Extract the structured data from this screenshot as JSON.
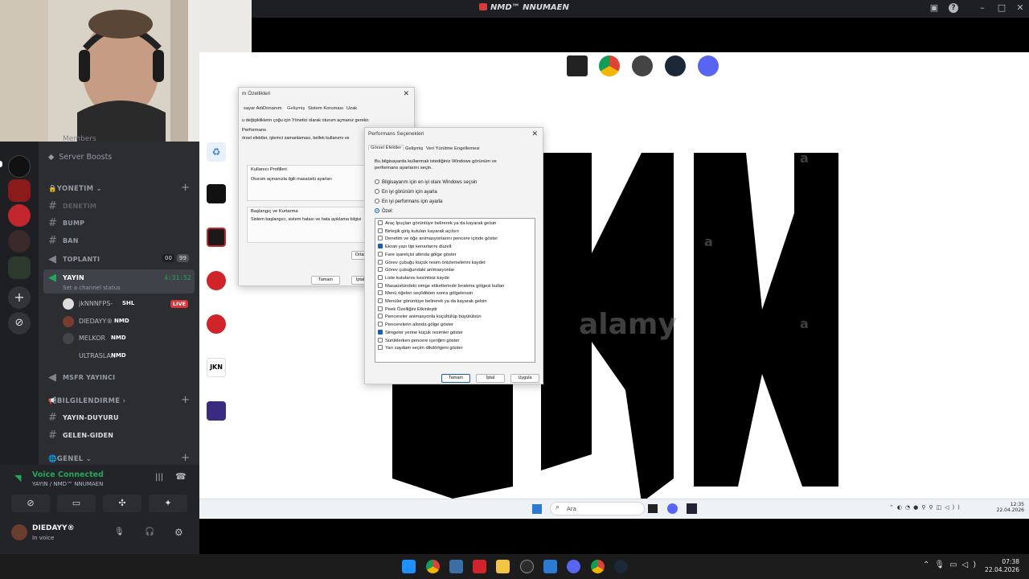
{
  "titlebar": {
    "title": "NMD™ NNUMAEN",
    "inbox_icon": "inbox-icon",
    "help_icon": "help-icon"
  },
  "discord": {
    "members_label": "Members",
    "server_boosts": "Server Boosts",
    "categories": {
      "yonetim": "YONETIM",
      "bilgilendirme": "BILGILENDIRME",
      "genel": "GENEL"
    },
    "channels": {
      "denetim": "DENETIM",
      "bump": "BUMP",
      "ban": "BAN",
      "toplanti": "TOPLANTI",
      "toplanti_count_a": "00",
      "toplanti_count_b": "99",
      "yayin": "YAYIN",
      "yayin_timer": "4:31:52",
      "set_status": "Set a channel status",
      "msfr": "MSFR YAYINCI",
      "duyuru": "YAYIN-DUYURU",
      "gelen": "GELEN-GIDEN"
    },
    "voice_users": [
      {
        "name": "jkNNNFPS-",
        "tag": "SHL",
        "live": "LIVE"
      },
      {
        "name": "DIEDAYY®",
        "tag": "NMD"
      },
      {
        "name": "MELKOR",
        "tag": "NMD"
      },
      {
        "name": "ULTRASLAN",
        "tag": "NMD"
      }
    ],
    "voice_panel": {
      "status": "Voice Connected",
      "channel": "YAYIN / NMD™ NNUMAEN",
      "username": "DIEDAYY®",
      "user_status": "In voice"
    }
  },
  "remote": {
    "bg_dialog": {
      "title": "m Özellikleri",
      "tabs": [
        "sayar Adı",
        "Donanım",
        "Gelişmiş",
        "Sistem Koruması",
        "Uzak"
      ],
      "note": "u değişikliklerin çoğu için Yönetici olarak oturum açmanız gerekir.",
      "perf_label": "Performans",
      "perf_text": "örsel efektler, işlemci zamanlaması, bellek kullanımı ve",
      "profile_label": "Kullanıcı Profilleri",
      "profile_text": "Oturum açmanızla ilgili masaüstü ayarları",
      "startup_label": "Başlangıç ve Kurtarma",
      "startup_text": "Sistem başlangıcı, sistem hatası ve hata ayıklama bilgisi",
      "btn_env": "Ortar",
      "btn_ok": "Tamam",
      "btn_cancel": "İptal"
    },
    "perf_dialog": {
      "title": "Performans Seçenekleri",
      "tabs": [
        "Görsel Efektler",
        "Gelişmiş",
        "Veri Yürütme Engellemesi"
      ],
      "intro": "Bu bilgisayarda kullanmak istediğiniz Windows görünüm ve performans ayarlarını seçin.",
      "radios": [
        "Bilgisayarım için en iyi olanı Windows seçsin",
        "En iyi görünüm için ayarla",
        "En iyi performans için ayarla",
        "Özel:"
      ],
      "items": [
        "Araç İpuçları görüntüye belirerek ya da kayarak gelsin",
        "Birleşik giriş kutuları kayarak açılsın",
        "Denetim ve öğe animasyonlarını pencere içinde göster",
        "Ekran yazı tipi kenarlarını düzelt",
        "Fare işaretçisi altında gölge göster",
        "Görev çubuğu küçük resim önizlemelerini kaydet",
        "Görev çubuğundaki animasyonlar",
        "Liste kutularını kesintisiz kaydır",
        "Masaüstündeki simge etiketlerinde bırakma gölgesi kullan",
        "Menü öğeleri seçildikten sonra gölgelensin",
        "Menüler görüntüye belirerek ya da kayarak gelsin",
        "Peek Özelliğini Etkinleştir",
        "Pencereler animasyonla küçültülüp büyütülsün",
        "Pencerelerin altında gölge göster",
        "Simgeler yerine küçük resimler göster",
        "Sürüklerken pencere içeriğini göster",
        "Yarı saydam seçim dikdörtgeni göster"
      ],
      "checked": [
        false,
        false,
        false,
        true,
        false,
        false,
        false,
        false,
        false,
        false,
        false,
        false,
        false,
        false,
        true,
        false,
        false
      ],
      "btn_ok": "Tamam",
      "btn_cancel": "İptal",
      "btn_apply": "Uygula"
    },
    "watermark": "alamy",
    "watermark_a": "a",
    "inner_taskbar": {
      "search": "Ara",
      "time": "12:35",
      "date": "22.04.2026"
    }
  },
  "host_taskbar": {
    "time": "07:38",
    "date": "22.04.2026"
  }
}
